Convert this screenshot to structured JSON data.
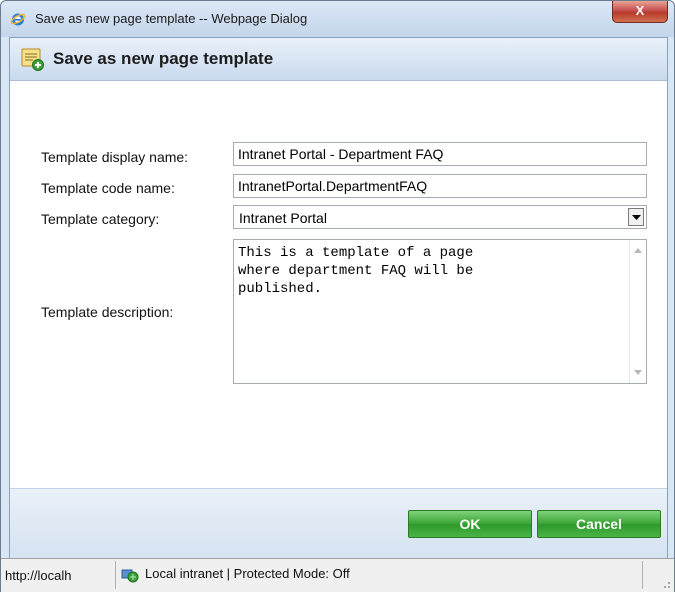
{
  "window": {
    "title": "Save as new page template -- Webpage Dialog",
    "close_label": "X"
  },
  "header": {
    "title": "Save as new page template"
  },
  "form": {
    "display_name": {
      "label": "Template display name:",
      "value": "Intranet Portal - Department FAQ"
    },
    "code_name": {
      "label": "Template code name:",
      "value": "IntranetPortal.DepartmentFAQ"
    },
    "category": {
      "label": "Template category:",
      "value": "Intranet Portal"
    },
    "description": {
      "label": "Template description:",
      "value": "This is a template of a page\nwhere department FAQ will be\npublished."
    }
  },
  "buttons": {
    "ok": "OK",
    "cancel": "Cancel"
  },
  "statusbar": {
    "url": "http://localh",
    "zone": "Local intranet | Protected Mode: Off"
  },
  "colors": {
    "button_green": "#3aa236",
    "header_blue": "#c9daee",
    "close_red": "#c75050"
  }
}
